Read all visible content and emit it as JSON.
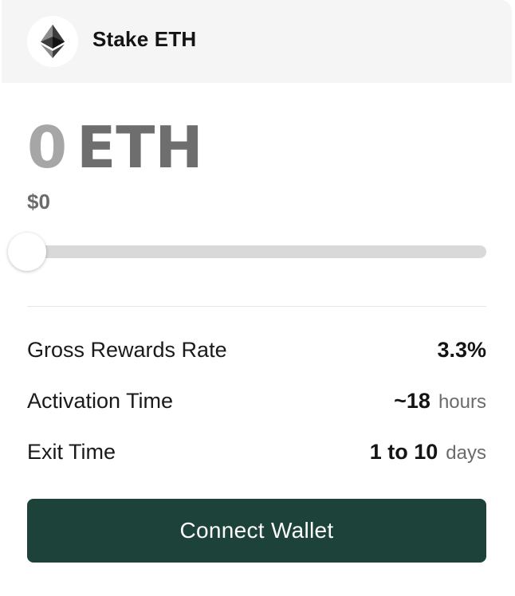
{
  "header": {
    "title": "Stake ETH",
    "logo_icon": "ethereum-icon"
  },
  "amount": {
    "value": "0",
    "unit": "ETH",
    "usd": "$0"
  },
  "slider": {
    "level_percent": 0
  },
  "stats": [
    {
      "label": "Gross Rewards Rate",
      "value": "3.3%",
      "unit": ""
    },
    {
      "label": "Activation Time",
      "value": "~18",
      "unit": "hours"
    },
    {
      "label": "Exit Time",
      "value": "1 to 10",
      "unit": "days"
    }
  ],
  "actions": {
    "connect_label": "Connect Wallet"
  },
  "colors": {
    "accent": "#1c4239",
    "header_bg": "#f5f5f5",
    "track": "#d9d9d9"
  }
}
